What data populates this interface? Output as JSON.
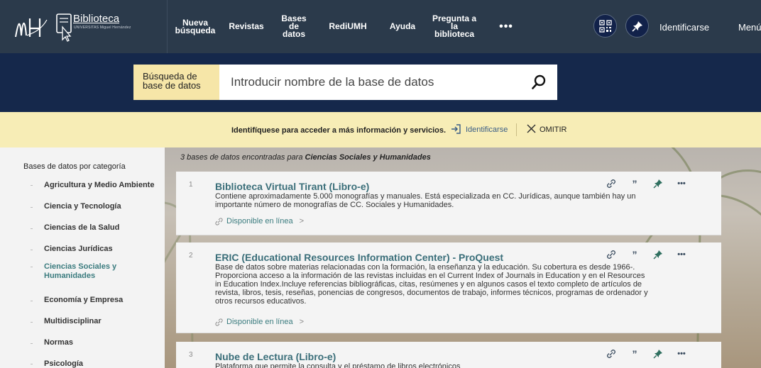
{
  "topnav": {
    "logo_text": "Biblioteca",
    "logo_subtext": "UNIVERSITAS Miguel Hernández",
    "items": [
      {
        "id": "new-search",
        "lines": [
          "Nueva",
          "búsqueda"
        ]
      },
      {
        "id": "journals",
        "lines": [
          "Revistas"
        ]
      },
      {
        "id": "databases",
        "lines": [
          "Bases de",
          "datos"
        ]
      },
      {
        "id": "rediumh",
        "lines": [
          "RediUMH"
        ]
      },
      {
        "id": "help",
        "lines": [
          "Ayuda"
        ]
      },
      {
        "id": "ask-library",
        "lines": [
          "Pregunta a",
          "la",
          "biblioteca"
        ]
      }
    ],
    "more": "•••",
    "login": "Identificarse",
    "menu": "Menú"
  },
  "search": {
    "label_lines": [
      "Búsqueda de",
      "base de datos"
    ],
    "placeholder": "Introducir nombre de la base de datos",
    "value": ""
  },
  "notice": {
    "text": "Identifíquese para acceder a más información y servicios.",
    "login": "Identificarse",
    "omit": "OMITIR"
  },
  "sidebar": {
    "title": "Bases de datos por categoría",
    "categories": [
      {
        "lines": [
          "Agricultura y Medio Ambiente"
        ],
        "active": false
      },
      {
        "lines": [
          "Ciencia y Tecnología"
        ],
        "active": false
      },
      {
        "lines": [
          "Ciencias de la Salud"
        ],
        "active": false
      },
      {
        "lines": [
          "Ciencias Jurídicas"
        ],
        "active": false
      },
      {
        "lines": [
          "Ciencias Sociales y",
          "Humanidades"
        ],
        "active": true
      },
      {
        "lines": [
          "Economía y Empresa"
        ],
        "active": false
      },
      {
        "lines": [
          "Multidisciplinar"
        ],
        "active": false
      },
      {
        "lines": [
          "Normas"
        ],
        "active": false
      },
      {
        "lines": [
          "Psicología"
        ],
        "active": false
      }
    ]
  },
  "results": {
    "count_prefix": "3 bases de datos encontradas para ",
    "count_query": "Ciencias Sociales y Humanidades",
    "items": [
      {
        "num": "1",
        "title": "Biblioteca Virtual Tirant (Libro-e)",
        "desc": "Contiene aproximadamente 5.000 monografías y manuales. Está especializada en CC. Jurídicas, aunque también hay un importante número de monografías de CC. Sociales y Humanidades.",
        "avail": "Disponible en línea"
      },
      {
        "num": "2",
        "title": "ERIC (Educational Resources Information Center) - ProQuest",
        "desc": "Base de datos sobre materias relacionadas con la formación, la enseñanza y la educación. Su cobertura es desde 1966-. Proporciona acceso a la información de las revistas incluidas en el Current Index of Journals in Education y en el Resources in Education Index.Incluye referencias bibliográficas, citas, resúmenes y en algunos casos el texto completo de artículos de revista, libros, tesis, reseñas, ponencias de congresos, documentos de trabajo, informes técnicos, programas de ordenador y otros recursos educativos.",
        "avail": "Disponible en línea"
      },
      {
        "num": "3",
        "title": "Nube de Lectura (Libro-e)",
        "desc": "Plataforma que permite la consulta y el préstamo de libros electrónicos",
        "avail": ""
      }
    ],
    "actions": {
      "quote": "”",
      "more": "•••"
    }
  },
  "colors": {
    "nav_bg": "#2b3a4b",
    "search_band": "#15284b",
    "notice_bg": "#f7edb6",
    "title_link": "#3a6e79",
    "accent_teal": "#3a7b7e"
  }
}
